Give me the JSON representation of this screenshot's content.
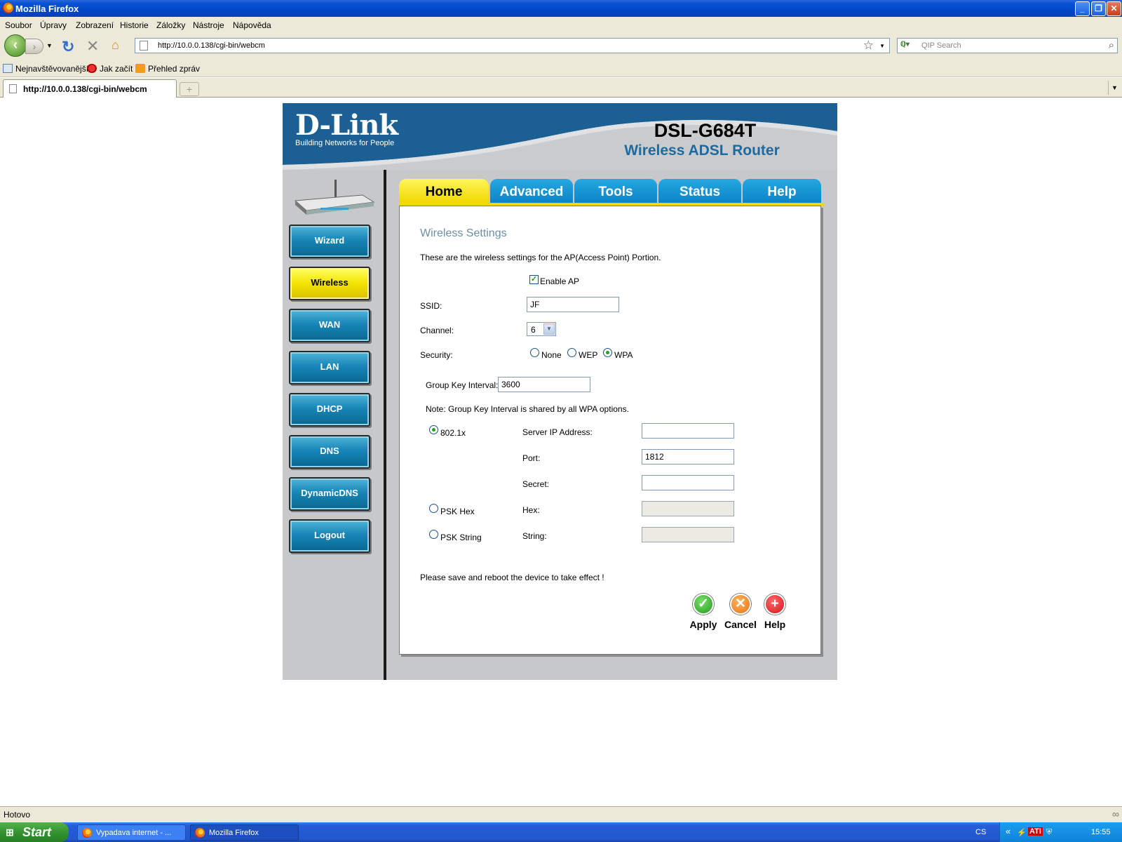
{
  "window": {
    "title": "Mozilla Firefox"
  },
  "menu": [
    "Soubor",
    "Úpravy",
    "Zobrazení",
    "Historie",
    "Záložky",
    "Nástroje",
    "Nápověda"
  ],
  "nav": {
    "url": "http://10.0.0.138/cgi-bin/webcm",
    "search_placeholder": "QIP Search"
  },
  "bookmarks": [
    "Nejnavštěvovanější",
    "Jak začít",
    "Přehled zpráv"
  ],
  "tab": {
    "label": "http://10.0.0.138/cgi-bin/webcm"
  },
  "router": {
    "logo": "D-Link",
    "tagline": "Building Networks for People",
    "model": "DSL-G684T",
    "subtitle": "Wireless ADSL Router",
    "tabs": [
      "Home",
      "Advanced",
      "Tools",
      "Status",
      "Help"
    ],
    "active_tab": "Home",
    "sidebar": [
      "Wizard",
      "Wireless",
      "WAN",
      "LAN",
      "DHCP",
      "DNS",
      "DynamicDNS",
      "Logout"
    ],
    "active_sidebar": "Wireless",
    "page_title": "Wireless Settings",
    "intro": "These are the wireless settings for the AP(Access Point) Portion.",
    "enable_ap_label": "Enable AP",
    "enable_ap_checked": true,
    "ssid_label": "SSID:",
    "ssid_value": "JF",
    "channel_label": "Channel:",
    "channel_value": "6",
    "security_label": "Security:",
    "security_options": [
      "None",
      "WEP",
      "WPA"
    ],
    "security_selected": "WPA",
    "group_key_label": "Group Key Interval:",
    "group_key_value": "3600",
    "note": "Note: Group Key Interval is shared by all WPA options.",
    "mode_8021x": "802.1x",
    "mode_psk_hex": "PSK Hex",
    "mode_psk_string": "PSK String",
    "mode_selected": "802.1x",
    "server_ip_label": "Server IP Address:",
    "server_ip_value": "",
    "port_label": "Port:",
    "port_value": "1812",
    "secret_label": "Secret:",
    "secret_value": "",
    "hex_label": "Hex:",
    "string_label": "String:",
    "reboot_note": "Please save and reboot the device to take effect !",
    "apply_label": "Apply",
    "cancel_label": "Cancel",
    "help_label": "Help"
  },
  "status": {
    "text": "Hotovo"
  },
  "taskbar": {
    "start_label": "Start",
    "tasks": [
      "Vypadava internet - ...",
      "Mozilla Firefox"
    ],
    "lang": "CS",
    "ati": "ATI",
    "clock": "15:55"
  },
  "colors": {
    "dlink_blue": "#1c6aa2",
    "active_yellow": "#f0d800",
    "tab_blue": "#0d84c8",
    "nav_teal": "#1786b8"
  }
}
